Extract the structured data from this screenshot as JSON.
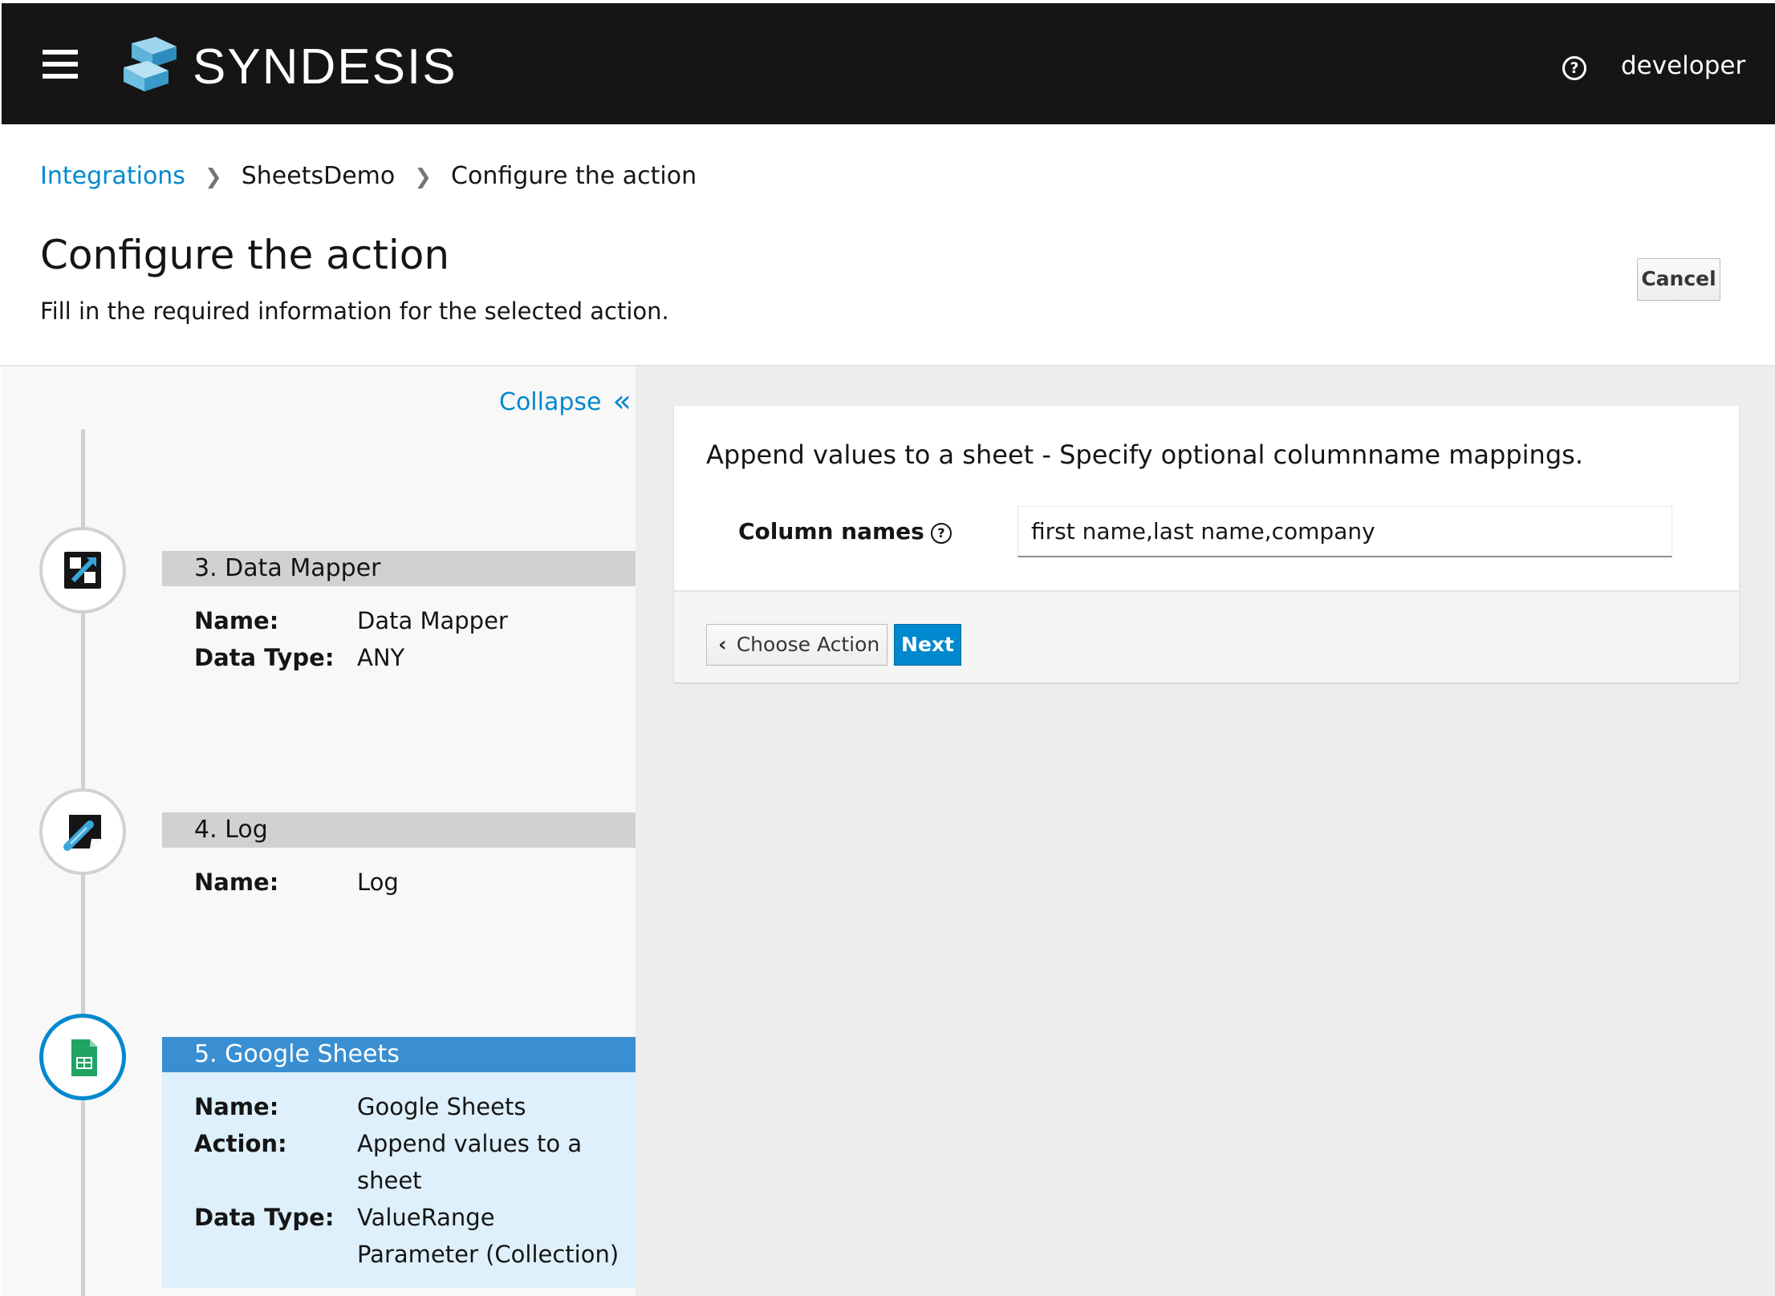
{
  "header": {
    "brand": "SYNDESIS",
    "user": "developer",
    "help_glyph": "?"
  },
  "breadcrumb": [
    {
      "label": "Integrations"
    },
    {
      "label": "SheetsDemo"
    },
    {
      "label": "Configure the action"
    }
  ],
  "page": {
    "title": "Configure the action",
    "subtitle": "Fill in the required information for the selected action.",
    "cancel_label": "Cancel"
  },
  "sidebar": {
    "collapse_label": "Collapse",
    "collapse_glyph": "«",
    "steps": [
      {
        "heading": "3. Data Mapper",
        "icon": "data-mapper-icon",
        "fields": [
          {
            "key": "Name:",
            "value": "Data Mapper"
          },
          {
            "key": "Data Type:",
            "value": "ANY"
          }
        ]
      },
      {
        "heading": "4. Log",
        "icon": "log-icon",
        "fields": [
          {
            "key": "Name:",
            "value": "Log"
          }
        ]
      },
      {
        "heading": "5. Google Sheets",
        "icon": "google-sheets-icon",
        "active": true,
        "fields": [
          {
            "key": "Name:",
            "value": "Google Sheets"
          },
          {
            "key": "Action:",
            "value": "Append values to a sheet"
          },
          {
            "key": "Data Type:",
            "value": "ValueRange Parameter (Collection)"
          }
        ]
      }
    ]
  },
  "form": {
    "title": "Append values to a sheet - Specify optional columnname mappings.",
    "column_names_label": "Column names",
    "column_names_value": "first name,last name,company",
    "back_label": "Choose Action",
    "back_glyph": "‹",
    "next_label": "Next"
  },
  "colors": {
    "accent": "#0088ce",
    "active_step": "#398fd1",
    "active_step_bg": "#def0fb",
    "header_bg": "#151515"
  }
}
